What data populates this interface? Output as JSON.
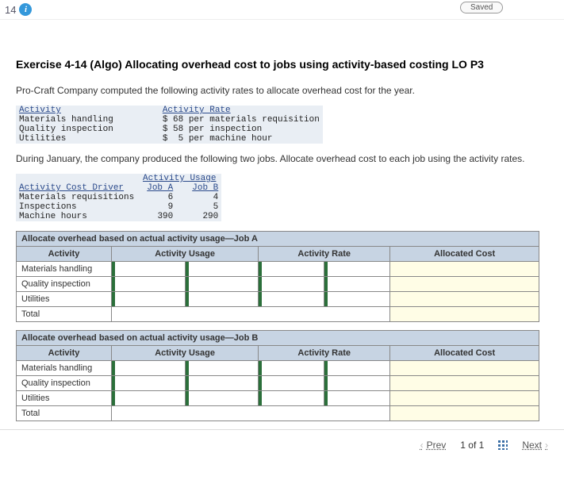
{
  "header": {
    "question_number": "14",
    "saved_label": "Saved"
  },
  "title": "Exercise 4-14 (Algo) Allocating overhead cost to jobs using activity-based costing LO P3",
  "intro": "Pro-Craft Company computed the following activity rates to allocate overhead cost for the year.",
  "rate_table": {
    "headers": {
      "activity": "Activity",
      "rate": "Activity Rate"
    },
    "rows": [
      {
        "activity": "Materials handling",
        "rate": "$ 68 per materials requisition"
      },
      {
        "activity": "Quality inspection",
        "rate": "$ 58 per inspection"
      },
      {
        "activity": "Utilities",
        "rate": "$  5 per machine hour"
      }
    ]
  },
  "usage_intro": "During January, the company produced the following two jobs. Allocate overhead cost to each job using the activity rates.",
  "usage_table": {
    "super_header": "Activity Usage",
    "headers": {
      "driver": "Activity Cost Driver",
      "jobA": "Job A",
      "jobB": "Job B"
    },
    "rows": [
      {
        "driver": "Materials requisitions",
        "jobA": "6",
        "jobB": "4"
      },
      {
        "driver": "Inspections",
        "jobA": "9",
        "jobB": "5"
      },
      {
        "driver": "Machine hours",
        "jobA": "390",
        "jobB": "290"
      }
    ]
  },
  "sheets": [
    {
      "section_title": "Allocate overhead based on actual activity usage—Job A",
      "col_headers": {
        "activity": "Activity",
        "usage": "Activity Usage",
        "rate": "Activity Rate",
        "cost": "Allocated Cost"
      },
      "rows": [
        "Materials handling",
        "Quality inspection",
        "Utilities"
      ],
      "total_label": "Total"
    },
    {
      "section_title": "Allocate overhead based on actual activity usage—Job B",
      "col_headers": {
        "activity": "Activity",
        "usage": "Activity Usage",
        "rate": "Activity Rate",
        "cost": "Allocated Cost"
      },
      "rows": [
        "Materials handling",
        "Quality inspection",
        "Utilities"
      ],
      "total_label": "Total"
    }
  ],
  "footer": {
    "prev": "Prev",
    "position": "1 of 1",
    "next": "Next"
  }
}
